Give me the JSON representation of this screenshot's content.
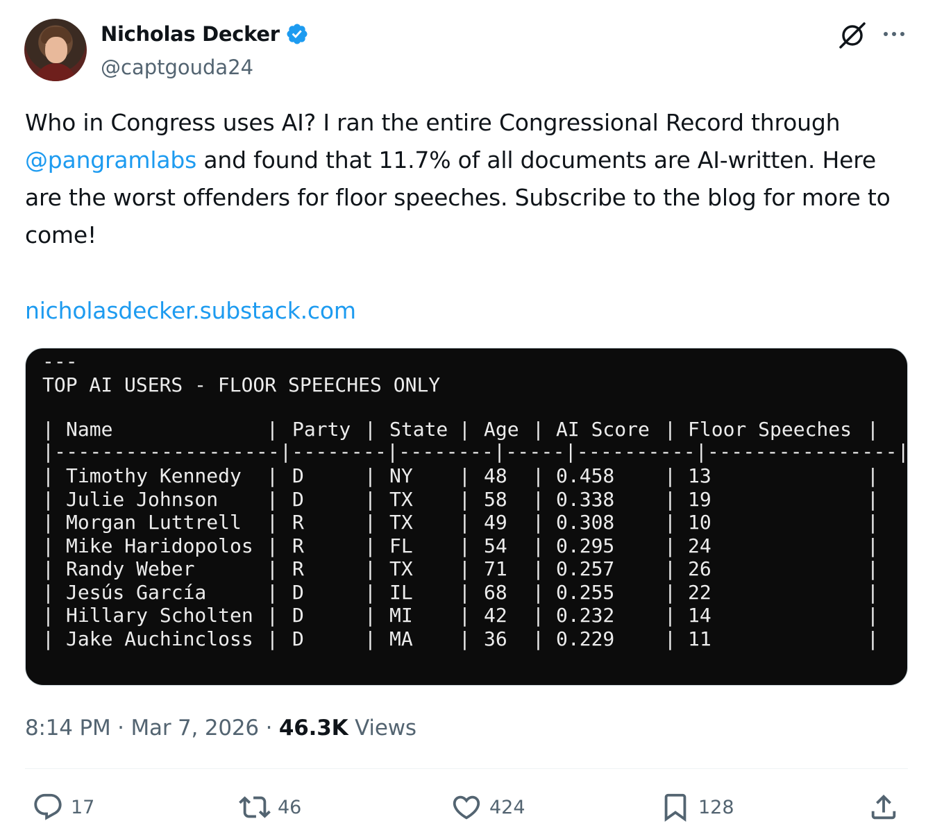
{
  "author": {
    "name": "Nicholas Decker",
    "handle": "@captgouda24"
  },
  "tweet": {
    "text_before": "Who in Congress uses AI? I ran the entire Congressional Record through ",
    "mention": "@pangramlabs",
    "text_after": " and found that 11.7% of all documents are AI-written. Here are the worst offenders for floor speeches. Subscribe to the blog for more to come!",
    "link": "nicholasdecker.substack.com"
  },
  "terminal": {
    "dash_line": "---",
    "title": "TOP AI USERS - FLOOR SPEECHES ONLY",
    "columns": [
      "Name",
      "Party",
      "State",
      "Age",
      "AI Score",
      "Floor Speeches"
    ],
    "rows": [
      [
        "Timothy Kennedy",
        "D",
        "NY",
        "48",
        "0.458",
        "13"
      ],
      [
        "Julie Johnson",
        "D",
        "TX",
        "58",
        "0.338",
        "19"
      ],
      [
        "Morgan Luttrell",
        "R",
        "TX",
        "49",
        "0.308",
        "10"
      ],
      [
        "Mike Haridopolos",
        "R",
        "FL",
        "54",
        "0.295",
        "24"
      ],
      [
        "Randy Weber",
        "R",
        "TX",
        "71",
        "0.257",
        "26"
      ],
      [
        "Jesús García",
        "D",
        "IL",
        "68",
        "0.255",
        "22"
      ],
      [
        "Hillary Scholten",
        "D",
        "MI",
        "42",
        "0.232",
        "14"
      ],
      [
        "Jake Auchincloss",
        "D",
        "MA",
        "36",
        "0.229",
        "11"
      ]
    ]
  },
  "meta": {
    "time": "8:14 PM",
    "date": "Mar 7, 2026",
    "views_count": "46.3K",
    "views_label": "Views",
    "sep": "·"
  },
  "actions": {
    "replies": "17",
    "reposts": "46",
    "likes": "424",
    "bookmarks": "128"
  },
  "colors": {
    "accent": "#1d9bf0",
    "muted": "#536471",
    "terminal_bg": "#0c0c0c"
  }
}
